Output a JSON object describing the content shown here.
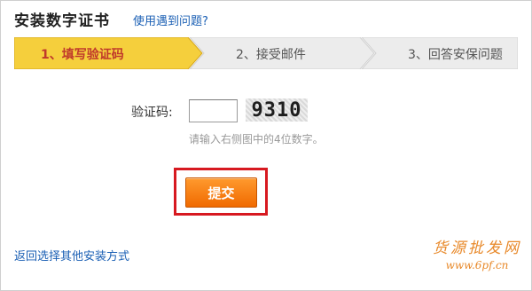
{
  "header": {
    "title": "安装数字证书",
    "help_link": "使用遇到问题?"
  },
  "steps": [
    {
      "label": "1、填写验证码",
      "active": true
    },
    {
      "label": "2、接受邮件",
      "active": false
    },
    {
      "label": "3、回答安保问题",
      "active": false
    }
  ],
  "form": {
    "code_label": "验证码:",
    "code_value": "",
    "captcha_text": "9310",
    "hint": "请输入右侧图中的4位数字。",
    "submit_label": "提交"
  },
  "footer": {
    "back_link": "返回选择其他安装方式"
  },
  "watermark": {
    "name": "货源批发网",
    "url": "www.6pf.cn"
  },
  "colors": {
    "active_step": "#f5cf3c",
    "inactive_step": "#ececec",
    "submit": "#f07800",
    "highlight": "#d71920",
    "link": "#1a5fb4"
  }
}
